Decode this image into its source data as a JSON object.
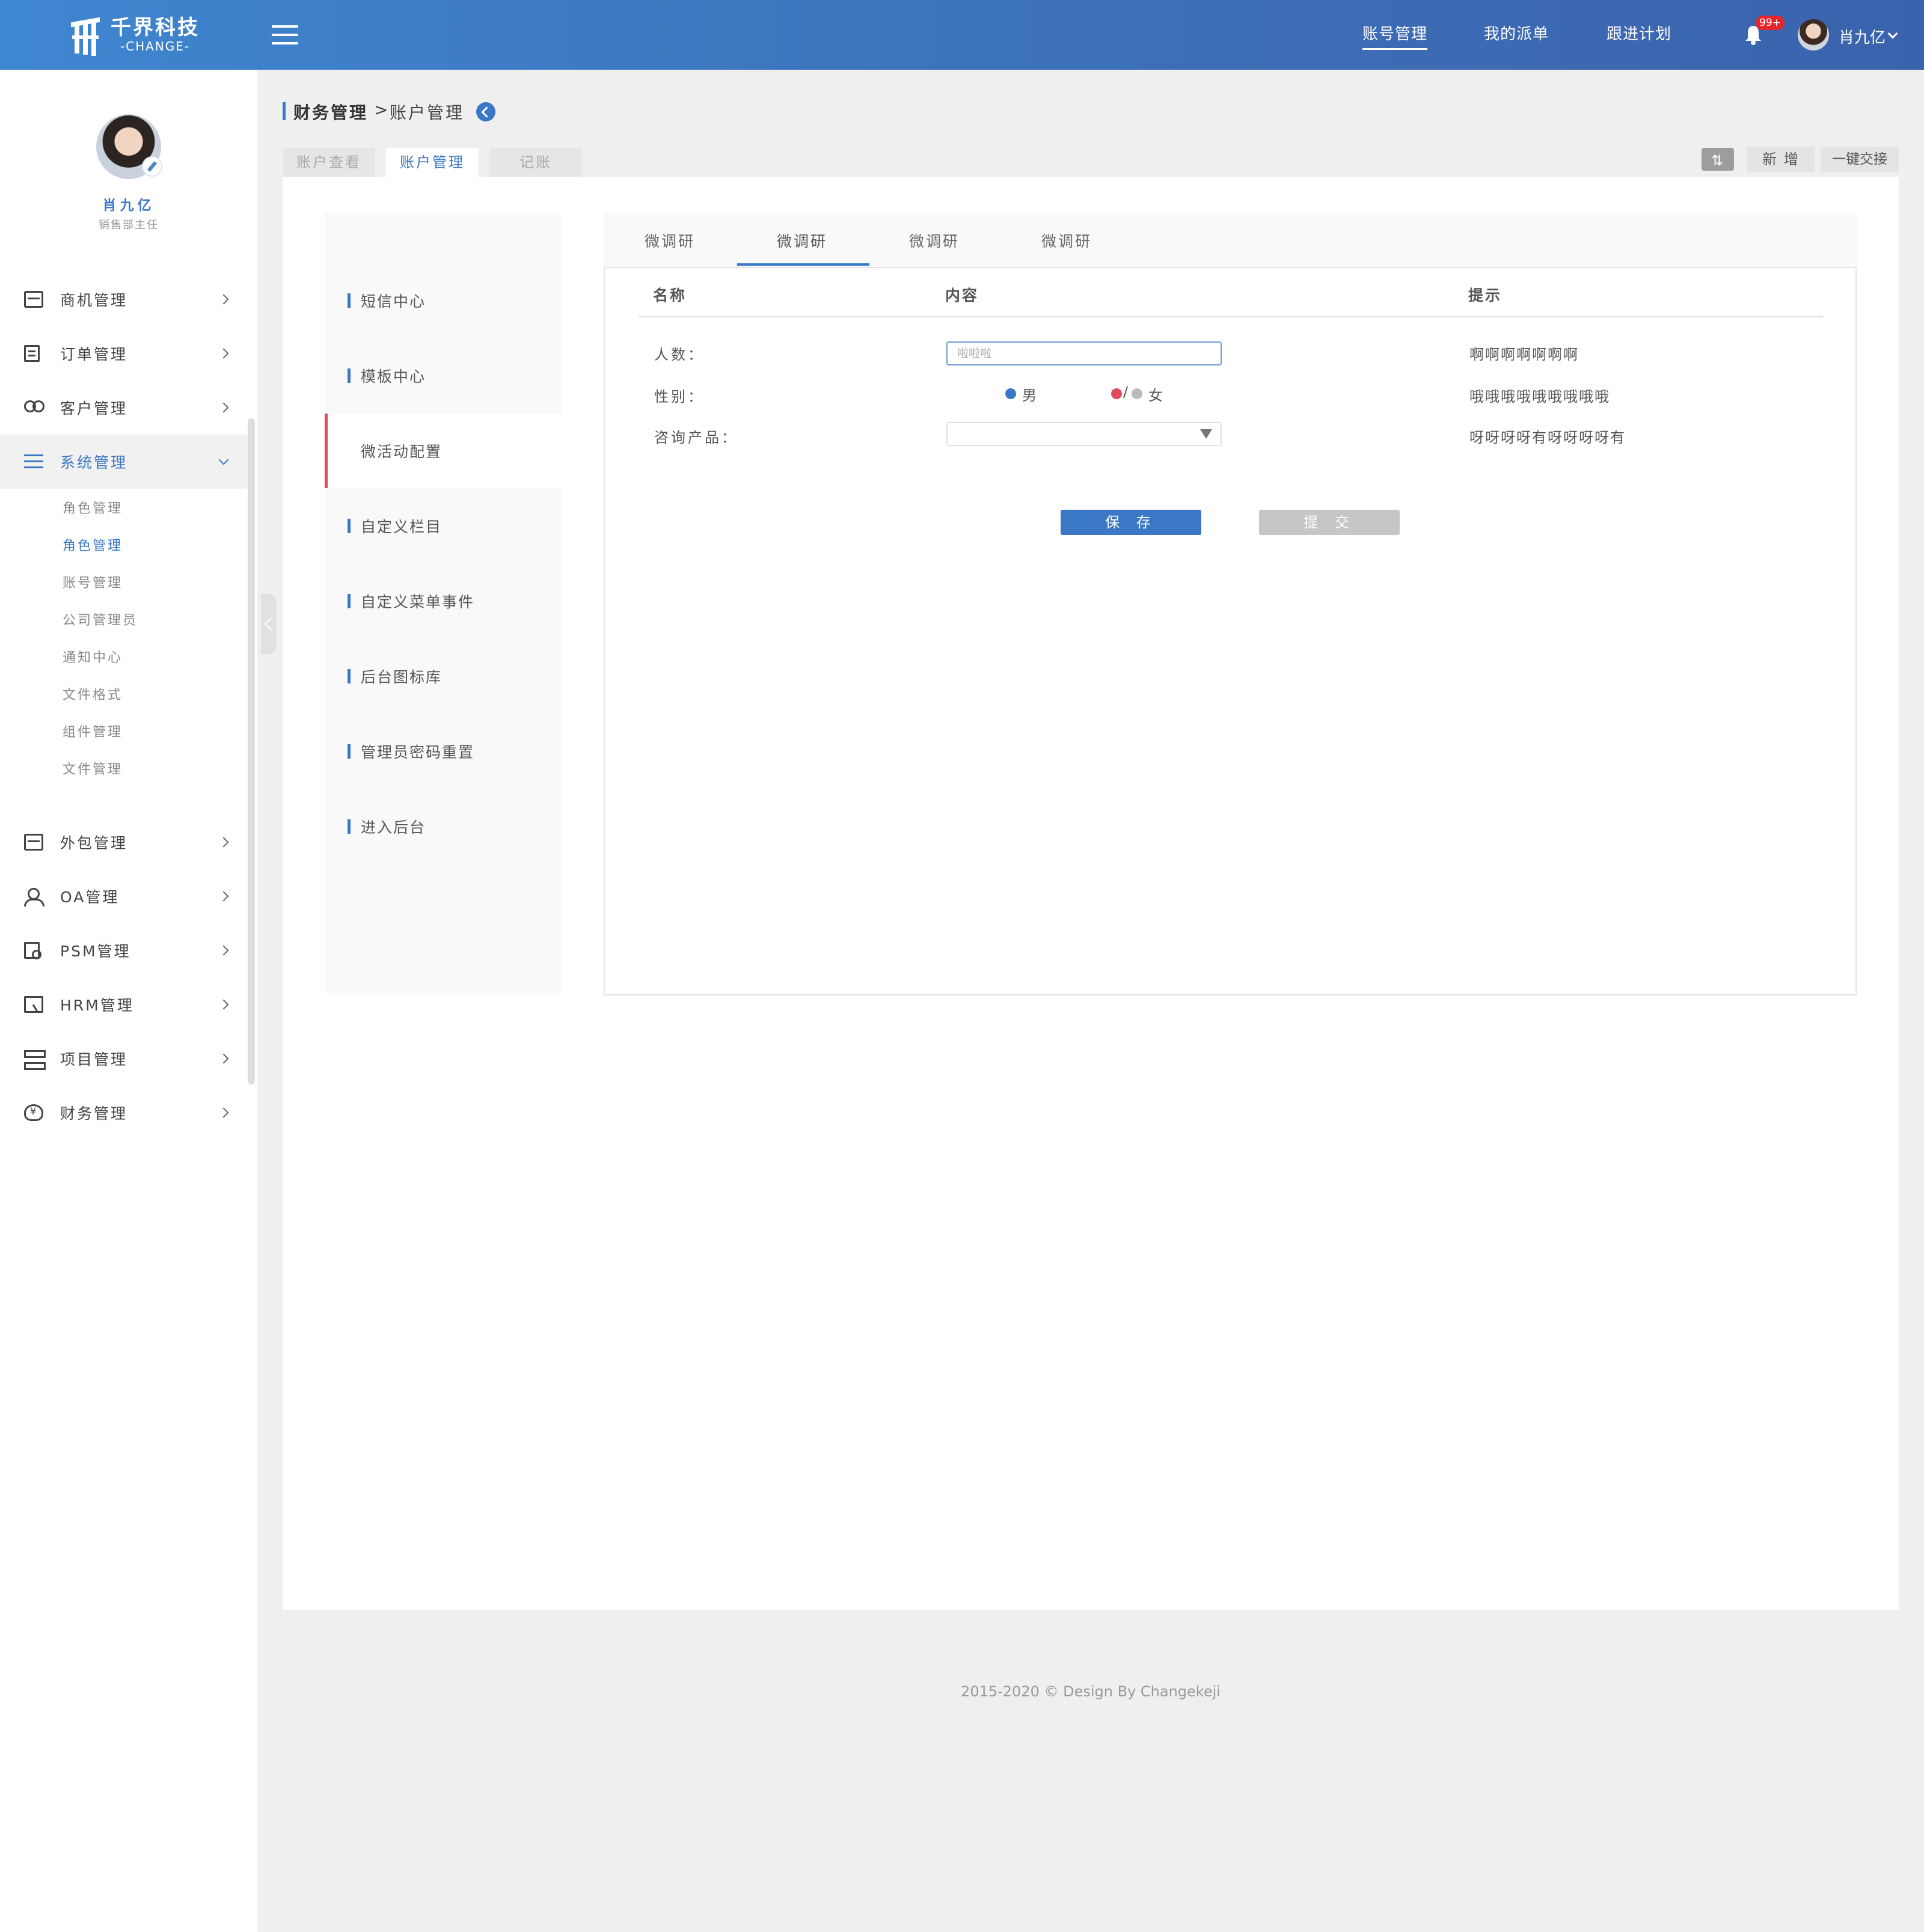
{
  "brand": {
    "title": "千界科技",
    "subtitle": "-CHANGE-"
  },
  "topnav": {
    "items": [
      "账号管理",
      "我的派单",
      "跟进计划"
    ],
    "active": 0
  },
  "notifications": {
    "badge": "99+"
  },
  "user": {
    "name_top": "肖九亿",
    "name": "肖九亿",
    "role": "销售部主任"
  },
  "sidebar": {
    "menu": [
      {
        "label": "商机管理",
        "icon": "briefcase-icon"
      },
      {
        "label": "订单管理",
        "icon": "edit-document-icon"
      },
      {
        "label": "客户管理",
        "icon": "people-icon"
      },
      {
        "label": "系统管理",
        "icon": "list-icon",
        "open": true
      },
      {
        "label": "外包管理",
        "icon": "briefcase-icon"
      },
      {
        "label": "OA管理",
        "icon": "person-settings-icon"
      },
      {
        "label": "PSM管理",
        "icon": "document-search-icon"
      },
      {
        "label": "HRM管理",
        "icon": "cursor-window-icon"
      },
      {
        "label": "项目管理",
        "icon": "stack-icon"
      },
      {
        "label": "财务管理",
        "icon": "money-bag-icon"
      }
    ],
    "submenu": [
      "角色管理",
      "角色管理",
      "账号管理",
      "公司管理员",
      "通知中心",
      "文件格式",
      "组件管理",
      "文件管理"
    ],
    "submenu_active": 1
  },
  "breadcrumb": {
    "section": "财务管理",
    "separator": ">",
    "page": "账户管理"
  },
  "tabs": [
    "账户查看",
    "账户管理",
    "记账"
  ],
  "tabs_active": 1,
  "toolbar": {
    "add": "新 增",
    "handover": "一键交接"
  },
  "left_menu": {
    "items": [
      "短信中心",
      "模板中心",
      "微活动配置",
      "自定义栏目",
      "自定义菜单事件",
      "后台图标库",
      "管理员密码重置",
      "进入后台"
    ],
    "active": 2
  },
  "sub_tabs": [
    "微调研",
    "微调研",
    "微调研",
    "微调研"
  ],
  "sub_tabs_active": 1,
  "form": {
    "headers": {
      "name": "名称",
      "content": "内容",
      "tip": "提示"
    },
    "rows": [
      {
        "label": "人数：",
        "placeholder": "啦啦啦",
        "tip": "啊啊啊啊啊啊啊"
      },
      {
        "label": "性别：",
        "options": {
          "male": "男",
          "female_sep": "/",
          "female": "女"
        },
        "tip": "哦哦哦哦哦哦哦哦哦"
      },
      {
        "label": "咨询产品：",
        "tip": "呀呀呀呀有呀呀呀呀有"
      }
    ],
    "buttons": {
      "save": "保 存",
      "submit": "提 交"
    }
  },
  "colors": {
    "accent": "#3a78c6",
    "active_marker": "#e04b5e",
    "header_gradient_start": "#3f86d0",
    "header_gradient_end": "#3b63ad"
  },
  "footer": "2015-2020 © Design By Changekeji"
}
